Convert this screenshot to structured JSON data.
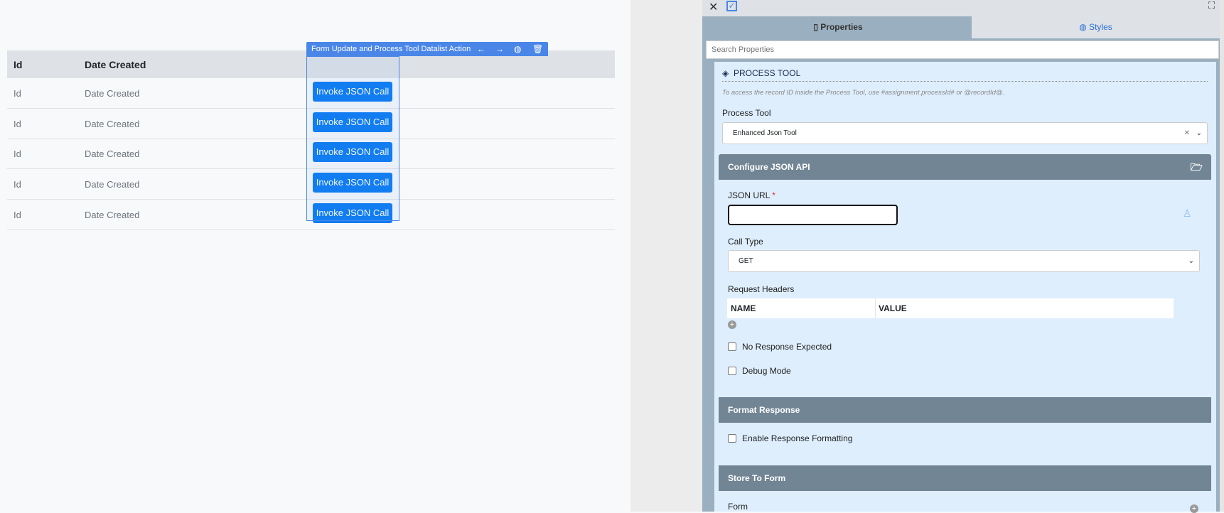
{
  "table": {
    "headers": [
      "Id",
      "Date Created"
    ],
    "rows": [
      {
        "id": "Id",
        "date": "Date Created",
        "action": "Invoke JSON Call"
      },
      {
        "id": "Id",
        "date": "Date Created",
        "action": "Invoke JSON Call"
      },
      {
        "id": "Id",
        "date": "Date Created",
        "action": "Invoke JSON Call"
      },
      {
        "id": "Id",
        "date": "Date Created",
        "action": "Invoke JSON Call"
      },
      {
        "id": "Id",
        "date": "Date Created",
        "action": "Invoke JSON Call"
      }
    ]
  },
  "element_toolbar": {
    "title": "Form Update and Process Tool Datalist Action",
    "icons": [
      "arrow-left-icon",
      "arrow-right-icon",
      "palette-icon",
      "trash-icon"
    ]
  },
  "panel": {
    "tabs": [
      {
        "label": "Properties",
        "active": true
      },
      {
        "label": "Styles",
        "active": false
      }
    ],
    "search_placeholder": "Search Properties",
    "section_title": "PROCESS TOOL",
    "hint": "To access the record ID inside the Process Tool, use #assignment.processId# or @recordId@.",
    "process_tool_label": "Process Tool",
    "process_tool_value": "Enhanced Json Tool",
    "configure": {
      "title": "Configure JSON API",
      "json_url_label": "JSON URL",
      "required": "*",
      "json_url_value": "",
      "call_type_label": "Call Type",
      "call_type_value": "GET",
      "request_headers_label": "Request Headers",
      "headers_cols": [
        "NAME",
        "VALUE"
      ],
      "no_response": "No Response Expected",
      "debug": "Debug Mode"
    },
    "format": {
      "title": "Format Response",
      "enable": "Enable Response Formatting"
    },
    "store": {
      "title": "Store To Form",
      "form_label": "Form"
    }
  },
  "colors": {
    "accent": "#0d7cf2",
    "section_header": "#718594",
    "panel_bg": "#deeefd"
  }
}
